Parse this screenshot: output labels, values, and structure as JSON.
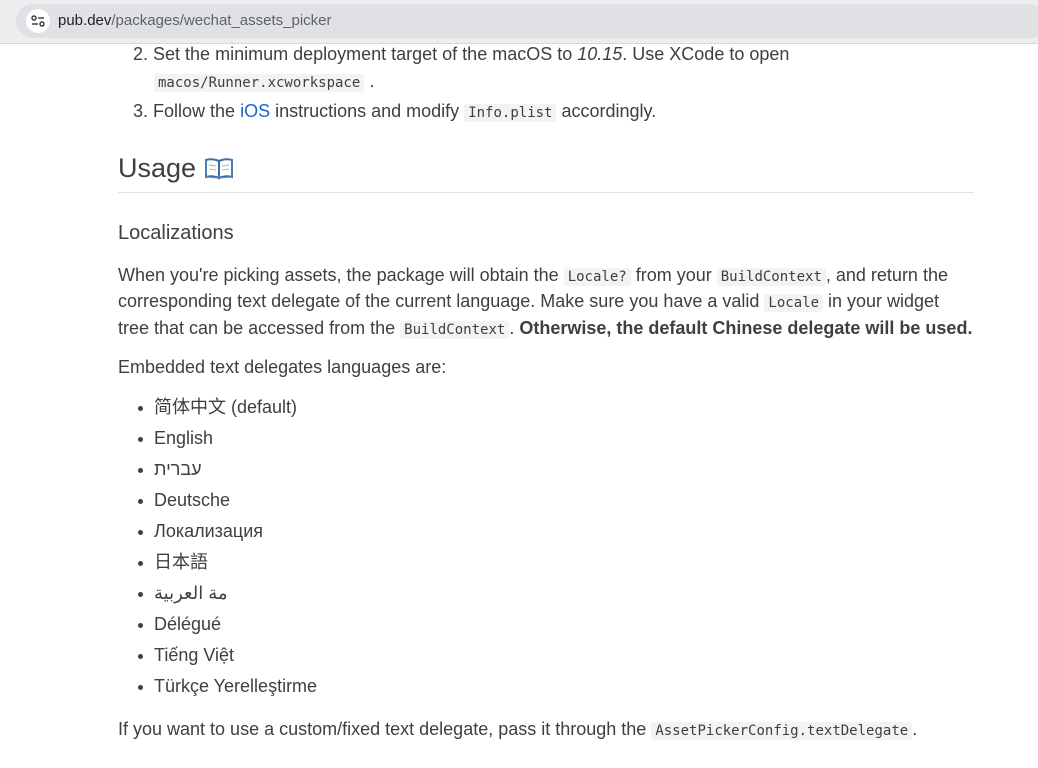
{
  "browser": {
    "url_host": "pub.dev",
    "url_path": "/packages/wechat_assets_picker"
  },
  "steps": {
    "item2_number": "2.",
    "item2_text_a": "Set the minimum deployment target of the macOS to ",
    "item2_version": "10.15",
    "item2_text_b": ". Use XCode to open",
    "item2_code": "macos/Runner.xcworkspace",
    "item2_end": ".",
    "item3_number": "3.",
    "item3_text_a": "Follow the ",
    "item3_link": "iOS",
    "item3_text_b": " instructions and modify ",
    "item3_code": "Info.plist",
    "item3_text_c": " accordingly."
  },
  "usage": {
    "heading": "Usage",
    "icon": "open-book-icon"
  },
  "localizations": {
    "heading": "Localizations",
    "p1_l1_a": "When you're picking assets, the package will obtain the ",
    "p1_l1_code1": "Locale?",
    "p1_l1_b": " from your ",
    "p1_l1_code2": "BuildContext",
    "p1_l1_c": ", and return the",
    "p1_l2_a": "corresponding text delegate of the current language. Make sure you have a valid ",
    "p1_l2_code": "Locale",
    "p1_l2_b": " in your widget",
    "p1_l3_a": "tree that can be accessed from the ",
    "p1_l3_code": "BuildContext",
    "p1_l3_b": ". ",
    "p1_l3_bold": "Otherwise, the default Chinese delegate will be used.",
    "languages_intro": "Embedded text delegates languages are:",
    "languages": [
      "简体中文 (default)",
      "English",
      "עברית",
      "Deutsche",
      "Локализация",
      "日本語",
      "مة العربية",
      "Délégué",
      "Tiếng Việt",
      "Türkçe Yerelleştirme"
    ],
    "footer_a": "If you want to use a custom/fixed text delegate, pass it through the ",
    "footer_code": "AssetPickerConfig.textDelegate",
    "footer_b": "."
  }
}
